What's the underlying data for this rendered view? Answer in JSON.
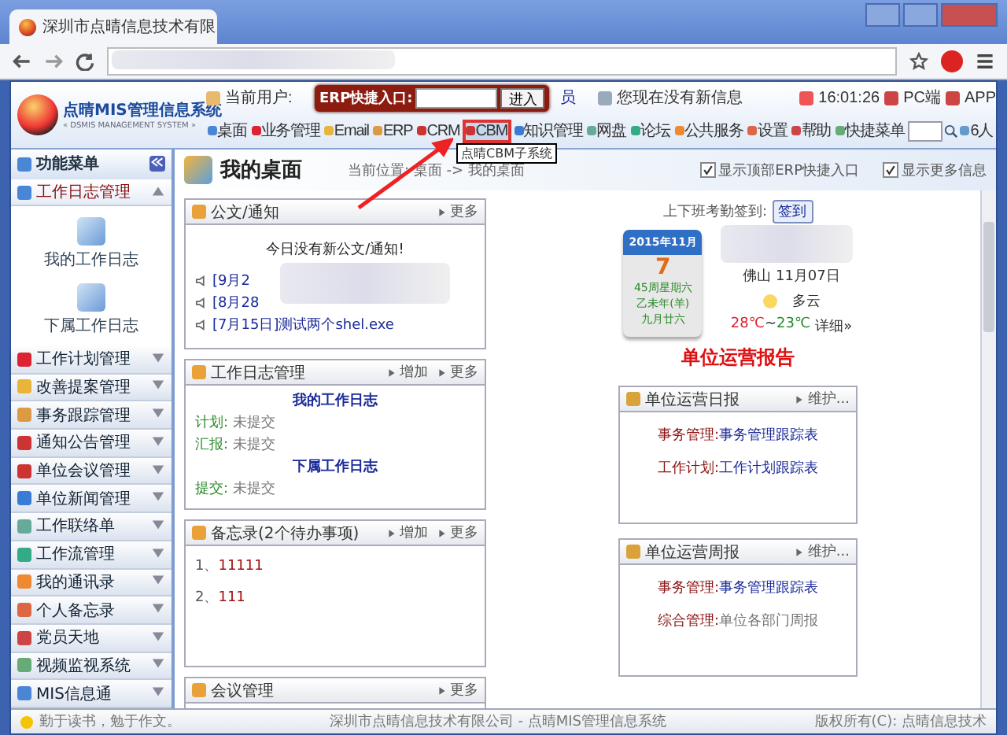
{
  "browser": {
    "tab_title": "深圳市点晴信息技术有限"
  },
  "header": {
    "system_name": "点晴MIS管理信息系统",
    "system_subtitle": "« DSMIS MANAGEMENT SYSTEM »",
    "user_label": "当前用户:",
    "user_fragment": "员",
    "messages": "您现在没有新信息",
    "time": "16:01:26",
    "links": [
      "PC端",
      "APP"
    ],
    "online_count": "6人"
  },
  "erp_quick_entry": {
    "label": "ERP快捷入口:",
    "button": "进入"
  },
  "nav": [
    {
      "label": "桌面",
      "selected": false
    },
    {
      "label": "业务管理",
      "selected": false
    },
    {
      "label": "Email",
      "selected": false
    },
    {
      "label": "ERP",
      "selected": false
    },
    {
      "label": "CRM",
      "selected": false
    },
    {
      "label": "CBM",
      "selected": true
    },
    {
      "label": "知识管理",
      "selected": false
    },
    {
      "label": "网盘",
      "selected": false
    },
    {
      "label": "论坛",
      "selected": false
    },
    {
      "label": "公共服务",
      "selected": false
    },
    {
      "label": "设置",
      "selected": false
    },
    {
      "label": "帮助",
      "selected": false
    },
    {
      "label": "快捷菜单",
      "selected": false
    }
  ],
  "tooltip": "点晴CBM子系统",
  "sidebar": {
    "title": "功能菜单",
    "groups": [
      {
        "label": "工作日志管理",
        "expanded": true,
        "children": [
          {
            "label": "我的工作日志"
          },
          {
            "label": "下属工作日志"
          }
        ]
      },
      {
        "label": "工作计划管理",
        "expanded": false
      },
      {
        "label": "改善提案管理",
        "expanded": false
      },
      {
        "label": "事务跟踪管理",
        "expanded": false
      },
      {
        "label": "通知公告管理",
        "expanded": false
      },
      {
        "label": "单位会议管理",
        "expanded": false
      },
      {
        "label": "单位新闻管理",
        "expanded": false
      },
      {
        "label": "工作联络单",
        "expanded": false
      },
      {
        "label": "工作流管理",
        "expanded": false
      },
      {
        "label": "我的通讯录",
        "expanded": false
      },
      {
        "label": "个人备忘录",
        "expanded": false
      },
      {
        "label": "党员天地",
        "expanded": false
      },
      {
        "label": "视频监视系统",
        "expanded": false
      },
      {
        "label": "MIS信息通",
        "expanded": false
      }
    ]
  },
  "main": {
    "title": "我的桌面",
    "breadcrumb": "当前位置: 桌面 -> 我的桌面",
    "options": [
      {
        "label": "显示顶部ERP快捷入口",
        "checked": true
      },
      {
        "label": "显示更多信息",
        "checked": true
      }
    ]
  },
  "left_panels": [
    {
      "title": "公文/通知",
      "actions": [
        "更多"
      ],
      "lines": [
        {
          "kind": "message",
          "text": "今日没有新公文/通知!"
        },
        {
          "kind": "notice",
          "text": "[9月2"
        },
        {
          "kind": "notice",
          "text": "[8月28"
        },
        {
          "kind": "notice",
          "text": "[7月15日]测试两个shel.exe"
        }
      ]
    },
    {
      "title": "工作日志管理",
      "actions": [
        "增加",
        "更多"
      ],
      "lines": [
        {
          "kind": "heading",
          "text": "我的工作日志"
        },
        {
          "kind": "status",
          "label": "计划:",
          "text": "未提交"
        },
        {
          "kind": "status",
          "label": "汇报:",
          "text": "未提交"
        },
        {
          "kind": "heading",
          "text": "下属工作日志"
        },
        {
          "kind": "status",
          "label": "提交:",
          "text": "未提交"
        }
      ]
    },
    {
      "title": "备忘录(2个待办事项)",
      "actions": [
        "增加",
        "更多"
      ],
      "lines": [
        {
          "kind": "memo",
          "label": "1、",
          "text": "11111"
        },
        {
          "kind": "memo",
          "label": "2、",
          "text": "111"
        }
      ]
    },
    {
      "title": "会议管理",
      "actions": [
        "更多"
      ]
    }
  ],
  "attendance": {
    "label": "上下班考勤签到:",
    "button": "签到"
  },
  "calendar": {
    "month": "2015年11月",
    "day": "7",
    "week": "45周星期六",
    "year": "乙未年(羊)",
    "lunar": "九月廿六"
  },
  "weather": {
    "date": "佛山 11月07日",
    "condition": "多云",
    "high": "28℃",
    "separator": "~",
    "low": "23℃",
    "details": "详细»"
  },
  "report_title": "单位运营报告",
  "report_panels": [
    {
      "title": "单位运营日报",
      "action": "维护...",
      "rows": [
        {
          "label": "事务管理:",
          "text": "事务管理跟踪表",
          "link": true
        },
        {
          "label": "工作计划:",
          "text": "工作计划跟踪表",
          "link": true
        }
      ]
    },
    {
      "title": "单位运营周报",
      "action": "维护...",
      "rows": [
        {
          "label": "事务管理:",
          "text": "事务管理跟踪表",
          "link": true
        },
        {
          "label": "综合管理:",
          "text": "单位各部门周报",
          "link": false
        }
      ]
    }
  ],
  "status_bar": {
    "motto": "勤于读书，勉于作文。",
    "company": "深圳市点晴信息技术有限公司 - 点晴MIS管理信息系统",
    "copyright": "版权所有(C): 点晴信息技术"
  }
}
